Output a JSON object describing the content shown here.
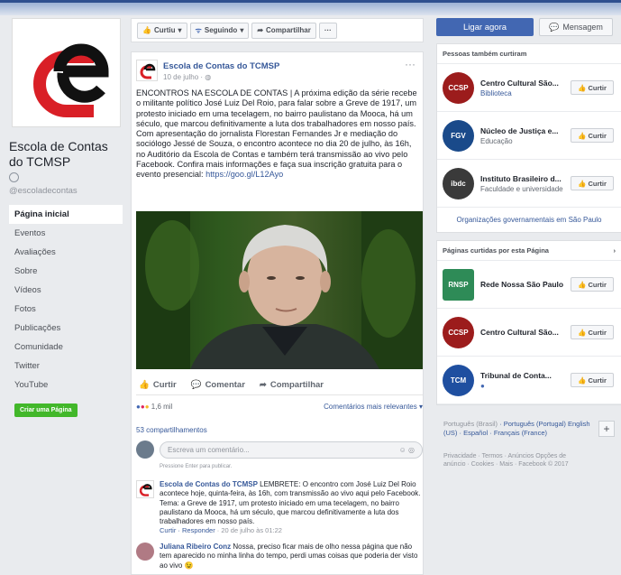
{
  "page": {
    "name": "Escola de Contas do TCMSP",
    "handle": "@escoladecontas"
  },
  "nav": [
    "Página inicial",
    "Eventos",
    "Avaliações",
    "Sobre",
    "Vídeos",
    "Fotos",
    "Publicações",
    "Comunidade",
    "Twitter",
    "YouTube"
  ],
  "create_page": "Criar uma Página",
  "actions": {
    "curtiu": "Curtiu",
    "seguindo": "Seguindo",
    "compartilhar": "Compartilhar",
    "more": "···"
  },
  "header_buttons": {
    "call": "Ligar agora",
    "message": "Mensagem"
  },
  "post": {
    "author": "Escola de Contas do TCMSP",
    "date": "10 de julho · ",
    "text1": "ENCONTROS NA ESCOLA DE CONTAS | A próxima edição da série recebe o militante político José Luiz Del Roio, para falar sobre a Greve de 1917, um protesto iniciado em uma tecelagem, no bairro paulistano da Mooca, há um século, que marcou definitivamente a luta dos trabalhadores em nosso país.",
    "text2": "Com apresentação do jornalista Florestan Fernandes Jr e mediação do sociólogo Jessé de Souza, o encontro acontece no dia 20 de julho, às 16h, no Auditório da Escola de Contas e também terá transmissão ao vivo pelo Facebook. Confira mais informações e faça sua inscrição gratuita para o evento presencial: ",
    "link": "https://goo.gl/L12Ayo",
    "like": "Curtir",
    "comment": "Comentar",
    "share": "Compartilhar",
    "reactions": "1,6 mil",
    "relevant": "Comentários mais relevantes ▾",
    "shares": "53 compartilhamentos",
    "comment_placeholder": "Escreva um comentário...",
    "enter_hint": "Pressione Enter para publicar.",
    "comments": [
      {
        "name": "Escola de Contas do TCMSP",
        "text": " LEMBRETE: O encontro com José Luiz Del Roio acontece hoje, quinta-feira, às 16h, com transmissão ao vivo aqui pelo Facebook. Tema: a Greve de 1917, um protesto iniciado em uma tecelagem, no bairro paulistano da Mooca, há um século, que marcou definitivamente a luta dos trabalhadores em nosso país.",
        "meta_links": "Curtir · Responder",
        "meta_date": " · 20 de julho às 01:22"
      },
      {
        "name": "Juliana Ribeiro Conz",
        "text": " Nossa, preciso ficar mais de olho nessa página que não tem aparecido no minha linha do tempo, perdi umas coisas que poderia der visto ao vivo 😉"
      }
    ]
  },
  "right": {
    "liked_header": "Pessoas também curtiram",
    "liked": [
      {
        "name": "Centro Cultural São...",
        "sub": "Biblioteca",
        "color": "#9c1c1c",
        "abbr": "CCSP"
      },
      {
        "name": "Núcleo de Justiça e...",
        "sub": "Educação",
        "color": "#1a4a8a",
        "abbr": "FGV"
      },
      {
        "name": "Instituto Brasileiro d...",
        "sub": "Faculdade e universidade",
        "color": "#3a3a3a",
        "abbr": "ibdc"
      }
    ],
    "gov_link": "Organizações governamentais em São Paulo",
    "pages_header": "Páginas curtidas por esta Página",
    "pages": [
      {
        "name": "Rede Nossa São Paulo",
        "color": "#2e8b57",
        "abbr": "RNSP"
      },
      {
        "name": "Centro Cultural São...",
        "color": "#9c1c1c",
        "abbr": "CCSP"
      },
      {
        "name": "Tribunal de Conta...",
        "color": "#1f4fa0",
        "abbr": "TCM"
      }
    ],
    "like_label": "Curtir",
    "lang_active": "Português (Brasil)",
    "lang_others": " · Português (Portugal) English (US) · Español · Français (France)",
    "footer": "Privacidade · Termos · Anúncios Opções de anúncio · Cookies · Mais · Facebook © 2017"
  }
}
